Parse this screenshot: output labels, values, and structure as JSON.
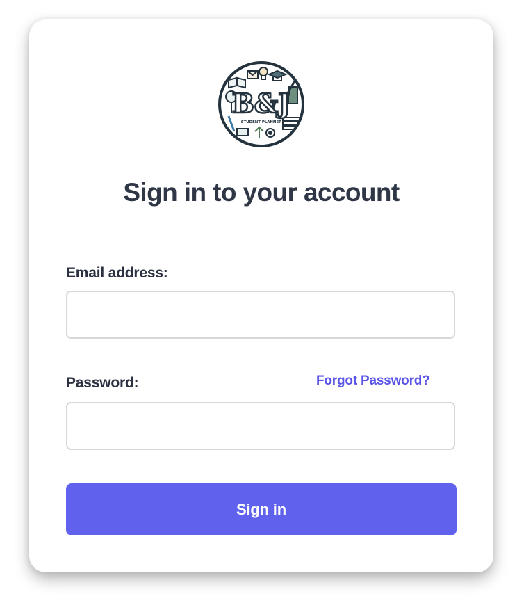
{
  "logo": {
    "monogram": "B&J",
    "caption": "STUDENT PLANNER"
  },
  "signin": {
    "title": "Sign in to your account",
    "email_label": "Email address:",
    "email_value": "",
    "password_label": "Password:",
    "password_value": "",
    "forgot_link": "Forgot Password?",
    "submit_label": "Sign in"
  },
  "colors": {
    "accent": "#6062ee",
    "link": "#5a55e6",
    "heading": "#2f3747",
    "input_border": "#d6d8db"
  }
}
